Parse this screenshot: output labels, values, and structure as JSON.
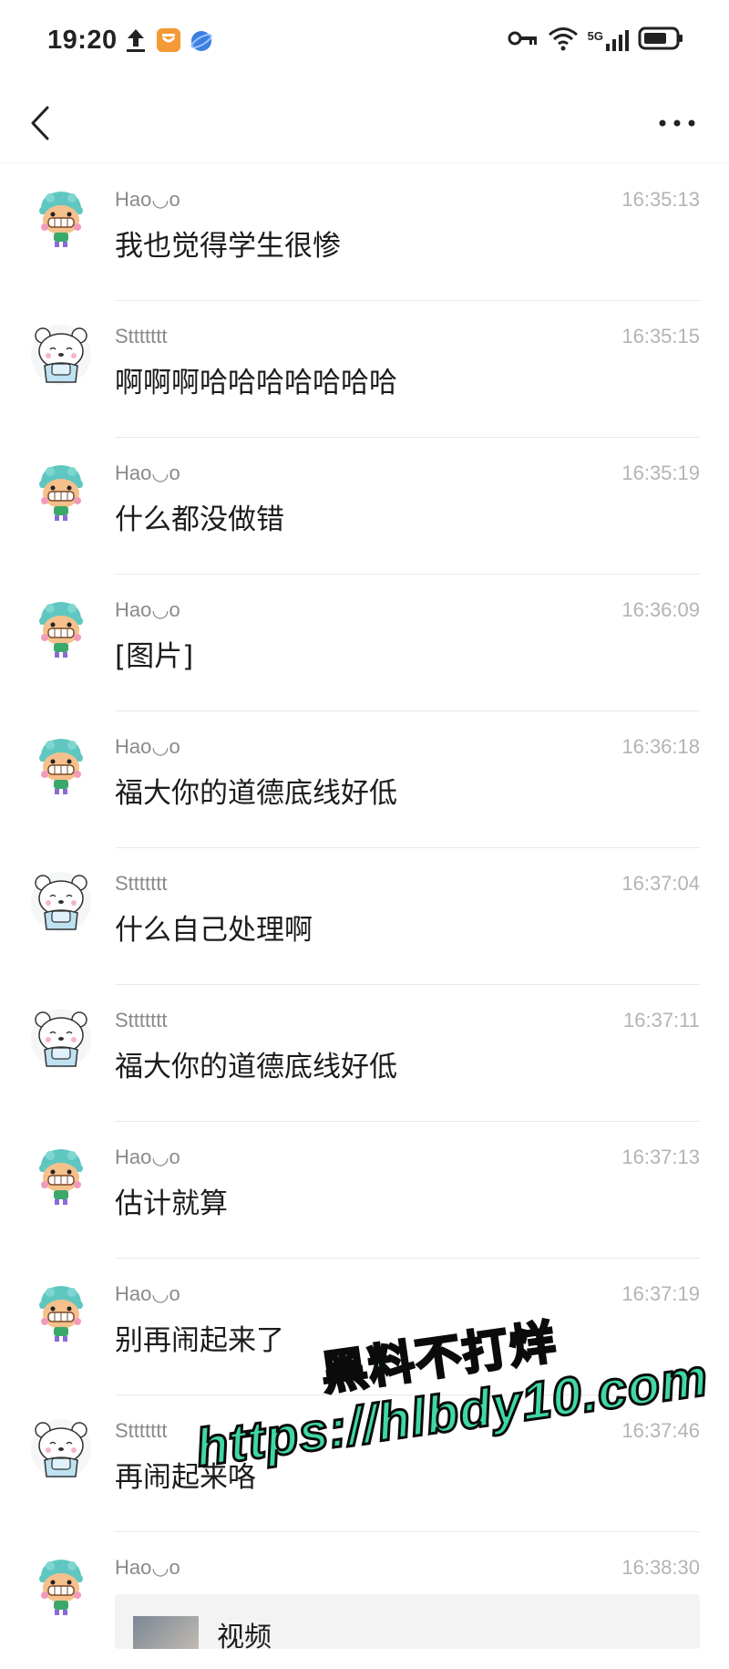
{
  "status_bar": {
    "time": "19:20",
    "network": "5G"
  },
  "messages": [
    {
      "sender": "Hao◡o",
      "time": "16:35:13",
      "text": "我也觉得学生很惨",
      "avatar": "boy-avatar"
    },
    {
      "sender": "Sttttttt",
      "time": "16:35:15",
      "text": "啊啊啊哈哈哈哈哈哈哈",
      "avatar": "bear-avatar"
    },
    {
      "sender": "Hao◡o",
      "time": "16:35:19",
      "text": "什么都没做错",
      "avatar": "boy-avatar"
    },
    {
      "sender": "Hao◡o",
      "time": "16:36:09",
      "text": "[图片]",
      "avatar": "boy-avatar"
    },
    {
      "sender": "Hao◡o",
      "time": "16:36:18",
      "text": "福大你的道德底线好低",
      "avatar": "boy-avatar"
    },
    {
      "sender": "Sttttttt",
      "time": "16:37:04",
      "text": "什么自己处理啊",
      "avatar": "bear-avatar"
    },
    {
      "sender": "Sttttttt",
      "time": "16:37:11",
      "text": "福大你的道德底线好低",
      "avatar": "bear-avatar"
    },
    {
      "sender": "Hao◡o",
      "time": "16:37:13",
      "text": "估计就算",
      "avatar": "boy-avatar"
    },
    {
      "sender": "Hao◡o",
      "time": "16:37:19",
      "text": "别再闹起来了",
      "avatar": "boy-avatar"
    },
    {
      "sender": "Sttttttt",
      "time": "16:37:46",
      "text": "再闹起来咯",
      "avatar": "bear-avatar"
    },
    {
      "sender": "Hao◡o",
      "time": "16:38:30",
      "video_label": "视频",
      "avatar": "boy-avatar"
    }
  ],
  "watermark": {
    "line1": "黑料不打烊",
    "line2": "https://hlbdy10.com",
    "color": "#3fd7a6"
  }
}
